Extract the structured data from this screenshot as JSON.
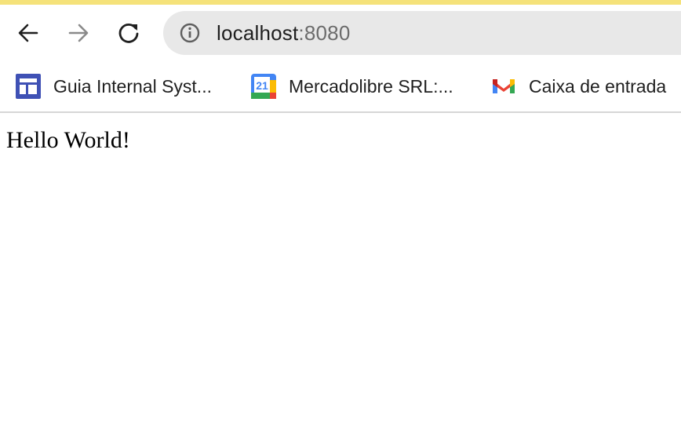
{
  "browser": {
    "address_bar": {
      "host": "localhost",
      "port": ":8080"
    },
    "nav": {
      "back_icon": "arrow-left-icon",
      "forward_icon": "arrow-right-icon",
      "reload_icon": "reload-icon",
      "site_info_icon": "info-circle-icon"
    },
    "bookmarks": [
      {
        "label": "Guia Internal Syst...",
        "icon": "dashboard-icon"
      },
      {
        "label": "Mercadolibre SRL:...",
        "icon": "calendar-icon",
        "icon_text": "21"
      },
      {
        "label": "Caixa de entrada",
        "icon": "gmail-icon"
      }
    ]
  },
  "page": {
    "body_text": "Hello World!"
  },
  "colors": {
    "top_stripe": "#f5e27a",
    "omnibox_bg": "#e8e8e8"
  }
}
